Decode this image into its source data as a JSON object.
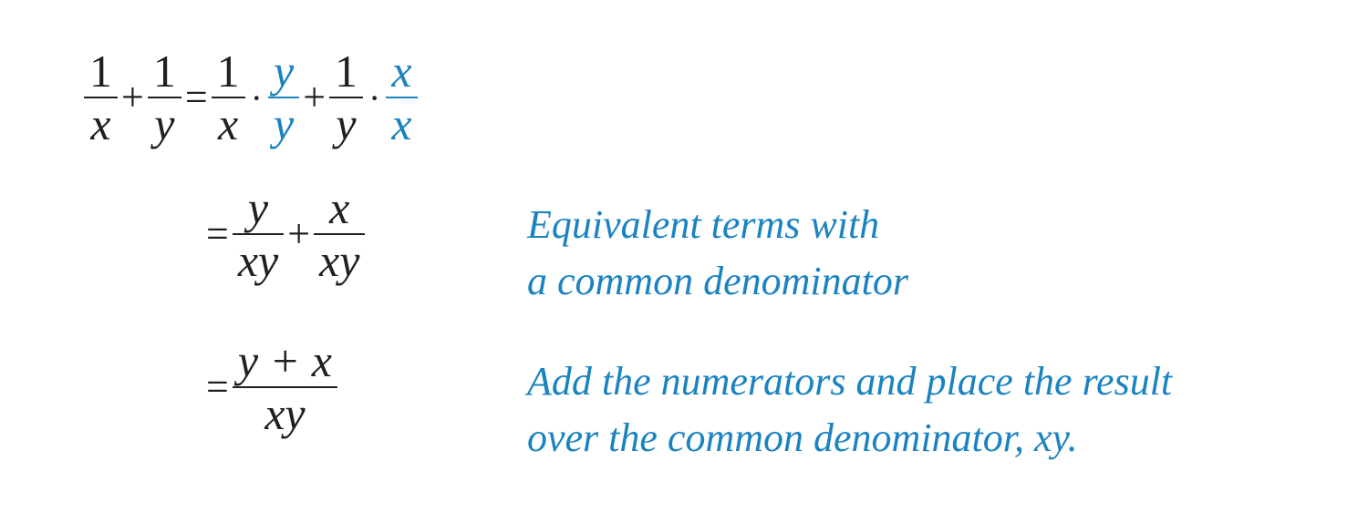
{
  "steps": [
    {
      "lhs": {
        "t1": {
          "num": "1",
          "den": "x"
        },
        "op": "+",
        "t2": {
          "num": "1",
          "den": "y"
        }
      },
      "eq": "=",
      "rhs": [
        {
          "num": "1",
          "den": "x"
        },
        {
          "dot": "·"
        },
        {
          "num": "y",
          "den": "y"
        },
        {
          "op": "+"
        },
        {
          "num": "1",
          "den": "y"
        },
        {
          "dot": "·"
        },
        {
          "num": "x",
          "den": "x"
        }
      ]
    },
    {
      "eq": "=",
      "a": {
        "num": "y",
        "den": "xy"
      },
      "op": "+",
      "b": {
        "num": "x",
        "den": "xy"
      }
    },
    {
      "eq": "=",
      "a": {
        "num": "y + x",
        "den": "xy"
      }
    }
  ],
  "notes": [
    {
      "line1": "Equivalent terms with",
      "line2": "a common denominator"
    },
    {
      "line1": "Add the numerators and place the result",
      "line2": "over the common denominator, xy."
    }
  ],
  "colors": {
    "accent": "#1b83c0",
    "text": "#231f20"
  }
}
